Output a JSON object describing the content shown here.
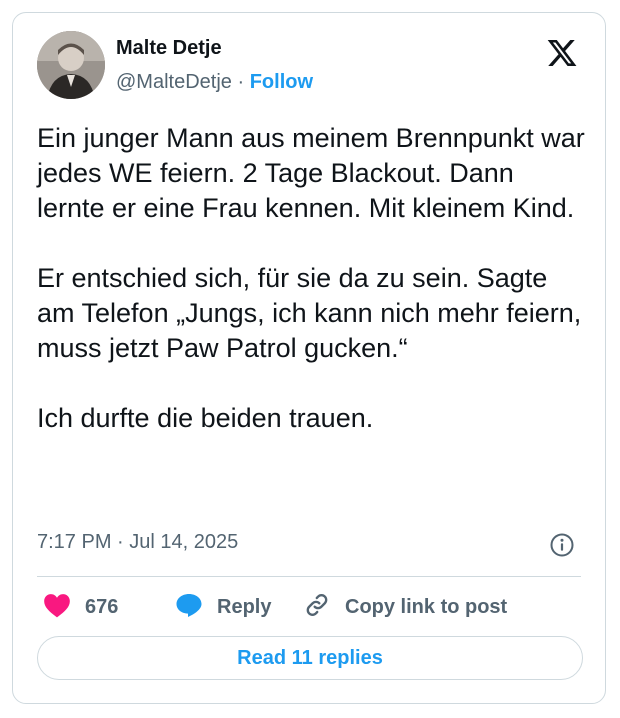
{
  "author": {
    "name": "Malte Detje",
    "handle": "@MalteDetje",
    "separator": "·",
    "follow_label": "Follow"
  },
  "tweet": {
    "paragraphs": [
      "Ein junger Mann aus meinem Brennpunkt war jedes WE feiern. 2 Tage Blackout. Dann lernte er eine Frau kennen. Mit kleinem Kind.",
      "Er entschied sich, für sie da zu sein. Sagte am Telefon „Jungs, ich kann nich mehr feiern, muss jetzt Paw Patrol gucken.“",
      "Ich durfte die beiden trauen."
    ],
    "timestamp": "7:17 PM · Jul 14, 2025"
  },
  "actions": {
    "like_count": "676",
    "reply_label": "Reply",
    "copy_label": "Copy link to post"
  },
  "footer": {
    "read_replies_label": "Read 11 replies"
  },
  "colors": {
    "accent": "#1d9bf0",
    "like": "#f91880",
    "secondary_text": "#536471",
    "border": "#cfd9de"
  },
  "icons": [
    "x-logo-icon",
    "info-icon",
    "heart-icon",
    "reply-bubble-icon",
    "link-icon"
  ]
}
